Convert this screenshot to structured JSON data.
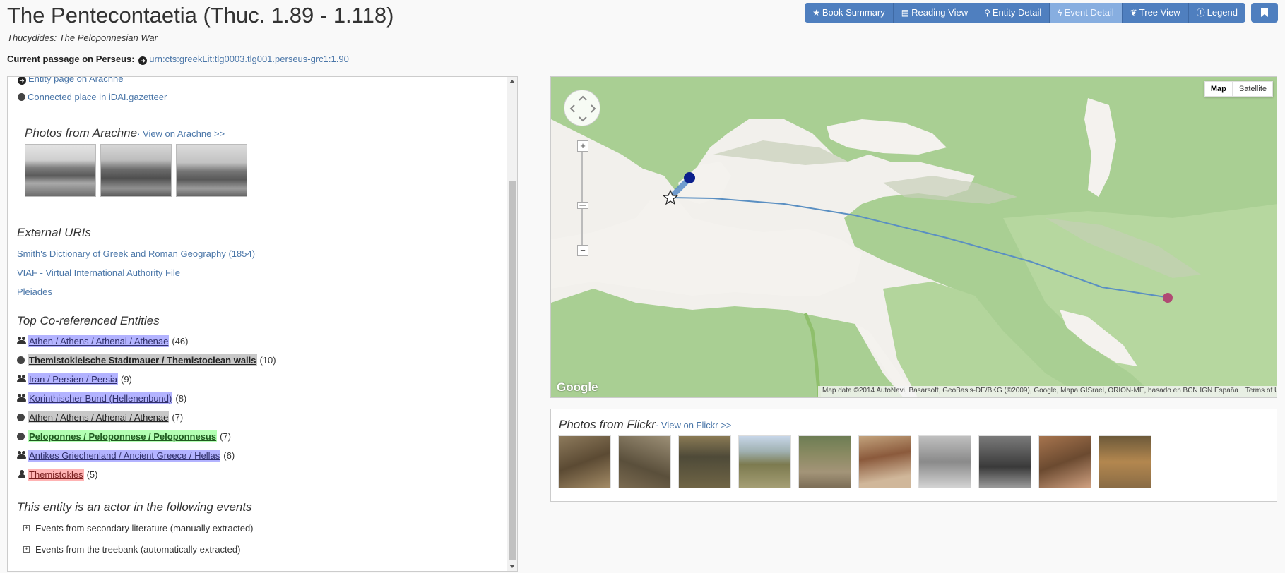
{
  "header": {
    "title": "The Pentecontaetia (Thuc. 1.89 - 1.118)",
    "subtitle": "Thucydides: The Peloponnesian War",
    "passage_label": "Current passage on Perseus:",
    "passage_urn": "urn:cts:greekLit:tlg0003.tlg001.perseus-grc1:1.90"
  },
  "toolbar": {
    "buttons": [
      {
        "label": "Book Summary",
        "icon": "star-icon"
      },
      {
        "label": "Reading View",
        "icon": "book-icon"
      },
      {
        "label": "Entity Detail",
        "icon": "map-marker-icon"
      },
      {
        "label": "Event Detail",
        "icon": "bolt-icon",
        "active": true
      },
      {
        "label": "Tree View",
        "icon": "leaf-icon"
      },
      {
        "label": "Legend",
        "icon": "info-icon"
      }
    ],
    "bookmark_icon": "bookmark-icon"
  },
  "left": {
    "links": [
      {
        "label": "Entity page on Arachne",
        "icon": "circle-arrow-icon"
      },
      {
        "label": "Connected place in iDAI.gazetteer",
        "icon": "globe-icon"
      }
    ],
    "photos_heading": "Photos from Arachne",
    "photos_link": "· View on Arachne >>",
    "external_heading": "External URIs",
    "external_uris": [
      "Smith's Dictionary of Greek and Roman Geography (1854)",
      "VIAF - Virtual International Authority File",
      "Pleiades"
    ],
    "coref_heading": "Top Co-referenced Entities",
    "entities": [
      {
        "label": "Athen / Athens / Athenai / Athenae",
        "count": "(46)",
        "type": "group",
        "color": "#b3b3ff"
      },
      {
        "label": "Themistokleische Stadtmauer / Themistoclean walls",
        "count": "(10)",
        "type": "place",
        "color": "#c8c8c8"
      },
      {
        "label": "Iran / Persien / Persia",
        "count": "(9)",
        "type": "group",
        "color": "#b3b3ff"
      },
      {
        "label": "Korinthischer Bund (Hellenenbund)",
        "count": "(8)",
        "type": "group",
        "color": "#b3b3ff"
      },
      {
        "label": "Athen / Athens / Athenai / Athenae",
        "count": "(7)",
        "type": "place",
        "color": "#c8c8c8"
      },
      {
        "label": "Peloponnes / Peloponnese / Peloponnesus",
        "count": "(7)",
        "type": "place",
        "color": "#b3ffb3"
      },
      {
        "label": "Antikes Griechenland / Ancient Greece / Hellas",
        "count": "(6)",
        "type": "group",
        "color": "#b3b3ff"
      },
      {
        "label": "Themistokles",
        "count": "(5)",
        "type": "person",
        "color": "#ffb3b3"
      }
    ],
    "events_heading": "This entity is an actor in the following events",
    "events": [
      "Events from secondary literature (manually extracted)",
      "Events from the treebank (automatically extracted)"
    ]
  },
  "map": {
    "type_buttons": [
      "Map",
      "Satellite"
    ],
    "logo": "Google",
    "attribution": "Map data ©2014 AutoNavi, Basarsoft, GeoBasis-DE/BKG (©2009), Google, Mapa GISrael, ORION-ME, basado en BCN IGN España",
    "terms": "Terms of Use",
    "zoom_in": "+",
    "zoom_out": "−"
  },
  "flickr": {
    "heading": "Photos from Flickr",
    "link": "· View on Flickr >>",
    "photo_count": 10
  }
}
